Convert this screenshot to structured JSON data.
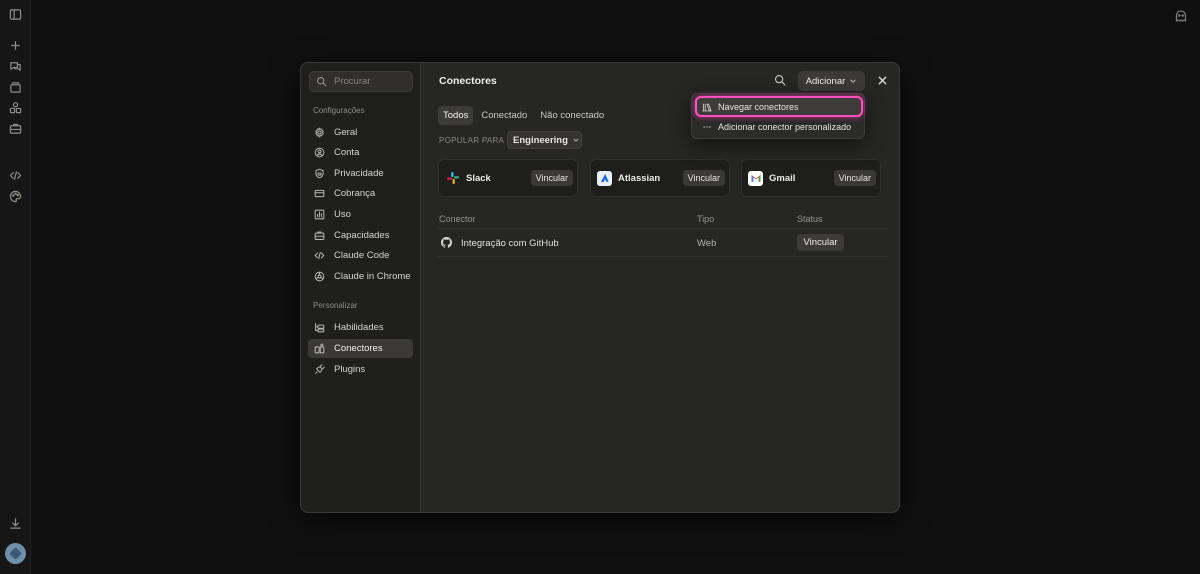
{
  "app": {
    "rail_icons": [
      "sidebar-toggle-icon",
      "plus-icon",
      "chats-icon",
      "projects-icon",
      "artifacts-icon",
      "briefcase-icon",
      "code-icon",
      "palette-icon",
      "download-icon"
    ],
    "top_right_icon": "ghost-icon"
  },
  "settings": {
    "search_placeholder": "Procurar",
    "sections": [
      {
        "label": "Configurações",
        "items": [
          {
            "label": "Geral",
            "icon": "gear-icon"
          },
          {
            "label": "Conta",
            "icon": "user-icon"
          },
          {
            "label": "Privacidade",
            "icon": "shield-icon"
          },
          {
            "label": "Cobrança",
            "icon": "card-icon"
          },
          {
            "label": "Uso",
            "icon": "bar-chart-icon"
          },
          {
            "label": "Capacidades",
            "icon": "briefcase-icon"
          },
          {
            "label": "Claude Code",
            "icon": "code-icon"
          },
          {
            "label": "Claude in Chrome",
            "icon": "globe-icon"
          }
        ]
      },
      {
        "label": "Personalizar",
        "items": [
          {
            "label": "Habilidades",
            "icon": "skills-icon"
          },
          {
            "label": "Conectores",
            "icon": "connectors-icon",
            "active": true
          },
          {
            "label": "Plugins",
            "icon": "plug-icon"
          }
        ]
      }
    ]
  },
  "main": {
    "title": "Conectores",
    "add_button": "Adicionar",
    "tabs": [
      {
        "label": "Todos",
        "active": true
      },
      {
        "label": "Conectado"
      },
      {
        "label": "Não conectado"
      }
    ],
    "popular_label": "POPULAR PARA",
    "popular_select": "Engineering",
    "cards": [
      {
        "name": "Slack",
        "button": "Vincular",
        "icon": "slack-logo"
      },
      {
        "name": "Atlassian",
        "button": "Vincular",
        "icon": "atlassian-logo"
      },
      {
        "name": "Gmail",
        "button": "Vincular",
        "icon": "gmail-logo"
      }
    ],
    "table": {
      "columns": [
        "Conector",
        "Tipo",
        "Status"
      ],
      "rows": [
        {
          "name": "Integração com GitHub",
          "type": "Web",
          "status_button": "Vincular",
          "icon": "github-icon"
        }
      ]
    }
  },
  "menu": {
    "items": [
      {
        "label": "Navegar conectores",
        "icon": "library-icon",
        "highlighted": true
      },
      {
        "label": "Adicionar conector personalizado",
        "icon": "more-dots-icon"
      }
    ],
    "highlight_color": "#ff4fbf"
  }
}
